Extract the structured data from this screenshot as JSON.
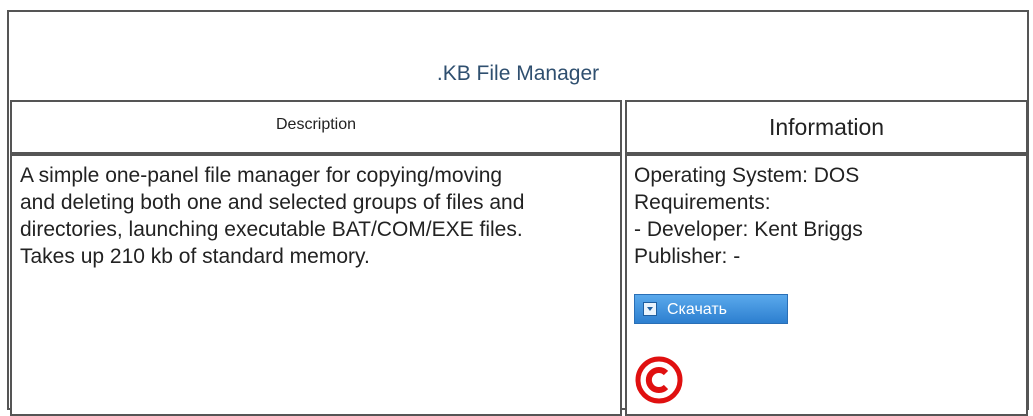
{
  "page": {
    "title": ".KB File Manager"
  },
  "table": {
    "headers": {
      "description": "Description",
      "information": "Information"
    },
    "description_text": "A simple one-panel file manager for copying/moving and deleting both one and selected groups of files and directories, launching executable BAT/COM/EXE files. Takes up 210 kb of standard memory.",
    "information_lines": [
      "Operating System: DOS",
      "Requirements:",
      "- Developer: Kent Briggs",
      "Publisher: -"
    ],
    "download_button_label": "Скачать"
  },
  "icons": {
    "download": "download-icon",
    "copyright": "copyright-icon"
  },
  "colors": {
    "title": "#2f4f6f",
    "button_top": "#5aa9ec",
    "button_bottom": "#2d7fd0",
    "copyright_red": "#e01010"
  }
}
